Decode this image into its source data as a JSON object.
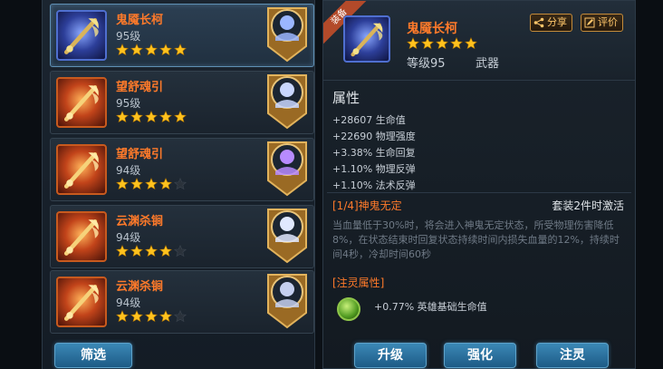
{
  "equipment_list": [
    {
      "name": "鬼魇长柯",
      "level": "95级",
      "stars": 5,
      "rarity": "blue",
      "selected": true
    },
    {
      "name": "望舒魂引",
      "level": "95级",
      "stars": 5,
      "rarity": "orange",
      "selected": false
    },
    {
      "name": "望舒魂引",
      "level": "94级",
      "stars": 4,
      "rarity": "orange",
      "selected": false
    },
    {
      "name": "云渊杀锏",
      "level": "94级",
      "stars": 4,
      "rarity": "orange",
      "selected": false
    },
    {
      "name": "云渊杀锏",
      "level": "94级",
      "stars": 4,
      "rarity": "orange",
      "selected": false
    }
  ],
  "filter_label": "筛选",
  "detail": {
    "equipped_badge": "装备",
    "name": "鬼魇长柯",
    "stars": 5,
    "level": "等级95",
    "type": "武器",
    "share_label": "分享",
    "review_label": "评价",
    "attr_title": "属性",
    "attributes": [
      "+28607 生命值",
      "+22690 物理强度",
      "+3.38% 生命回复",
      "+1.10% 物理反弹",
      "+1.10% 法术反弹"
    ],
    "set_title": "[1/4]神鬼无定",
    "set_activation": "套装2件时激活",
    "set_desc": "当血量低于30%时，将会进入神鬼无定状态，所受物理伤害降低8%，在状态结束时回复状态持续时间内损失血量的12%，持续时间4秒，冷却时间60秒",
    "spirit_title": "[注灵属性]",
    "spirit_value": "+0.77% 英雄基础生命值"
  },
  "actions": {
    "upgrade_label": "升级",
    "enhance_label": "强化",
    "infuse_label": "注灵"
  },
  "colors": {
    "star_filled": "#ffc21e",
    "star_empty": "#2a323b",
    "item_name": "#ff7a2a",
    "button_blue": "#2f78a8"
  }
}
